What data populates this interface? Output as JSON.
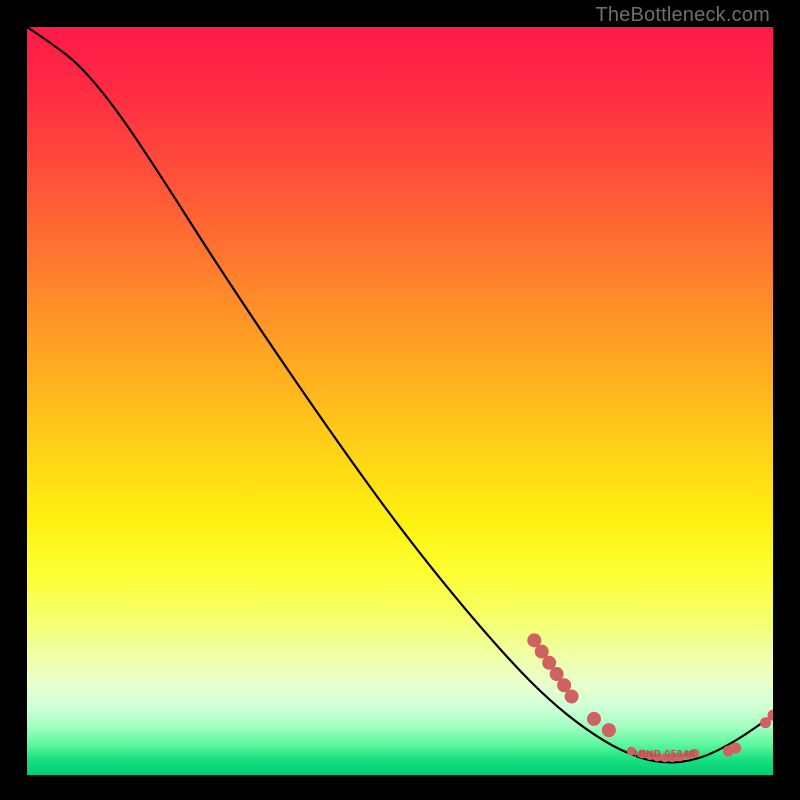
{
  "watermark": "TheBottleneck.com",
  "colors": {
    "curve": "#000000",
    "dot": "#cf6260",
    "label": "#b45250"
  },
  "chart_data": {
    "type": "line",
    "title": "",
    "xlabel": "",
    "ylabel": "",
    "xlim": [
      0,
      100
    ],
    "ylim": [
      0,
      100
    ],
    "grid": false,
    "legend": false,
    "curve": [
      {
        "x": 0,
        "y": 100
      },
      {
        "x": 3,
        "y": 98
      },
      {
        "x": 7,
        "y": 95
      },
      {
        "x": 12,
        "y": 89
      },
      {
        "x": 18,
        "y": 80
      },
      {
        "x": 25,
        "y": 69
      },
      {
        "x": 33,
        "y": 57
      },
      {
        "x": 42,
        "y": 44
      },
      {
        "x": 50,
        "y": 33
      },
      {
        "x": 58,
        "y": 23
      },
      {
        "x": 65,
        "y": 15
      },
      {
        "x": 70,
        "y": 10
      },
      {
        "x": 75,
        "y": 6
      },
      {
        "x": 80,
        "y": 3
      },
      {
        "x": 85,
        "y": 1.5
      },
      {
        "x": 90,
        "y": 2
      },
      {
        "x": 95,
        "y": 4.5
      },
      {
        "x": 100,
        "y": 8
      }
    ],
    "points_upper": [
      {
        "x": 68,
        "y": 18
      },
      {
        "x": 69,
        "y": 16.5
      },
      {
        "x": 70,
        "y": 15
      },
      {
        "x": 71,
        "y": 13.5
      },
      {
        "x": 72,
        "y": 12
      },
      {
        "x": 73,
        "y": 10.5
      },
      {
        "x": 76,
        "y": 7.5
      },
      {
        "x": 78,
        "y": 6
      }
    ],
    "points_plateau": [
      {
        "x": 81,
        "y": 3.2
      },
      {
        "x": 82.5,
        "y": 2.8
      },
      {
        "x": 83.5,
        "y": 2.6
      },
      {
        "x": 84.5,
        "y": 2.4
      },
      {
        "x": 85.5,
        "y": 2.3
      },
      {
        "x": 86.5,
        "y": 2.3
      },
      {
        "x": 87.5,
        "y": 2.4
      },
      {
        "x": 88.5,
        "y": 2.6
      },
      {
        "x": 89.5,
        "y": 2.9
      }
    ],
    "points_tail": [
      {
        "x": 94,
        "y": 3.2
      },
      {
        "x": 95,
        "y": 3.6
      },
      {
        "x": 99,
        "y": 7
      },
      {
        "x": 100,
        "y": 8
      }
    ],
    "plateau_label": "MIND 05048"
  }
}
